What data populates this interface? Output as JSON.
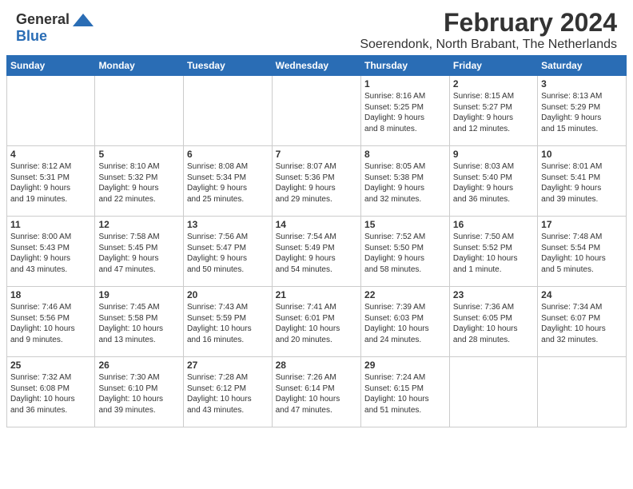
{
  "header": {
    "logo_general": "General",
    "logo_blue": "Blue",
    "title": "February 2024",
    "location": "Soerendonk, North Brabant, The Netherlands"
  },
  "days": [
    "Sunday",
    "Monday",
    "Tuesday",
    "Wednesday",
    "Thursday",
    "Friday",
    "Saturday"
  ],
  "weeks": [
    [
      {
        "day": "",
        "info": ""
      },
      {
        "day": "",
        "info": ""
      },
      {
        "day": "",
        "info": ""
      },
      {
        "day": "",
        "info": ""
      },
      {
        "day": "1",
        "info": "Sunrise: 8:16 AM\nSunset: 5:25 PM\nDaylight: 9 hours\nand 8 minutes."
      },
      {
        "day": "2",
        "info": "Sunrise: 8:15 AM\nSunset: 5:27 PM\nDaylight: 9 hours\nand 12 minutes."
      },
      {
        "day": "3",
        "info": "Sunrise: 8:13 AM\nSunset: 5:29 PM\nDaylight: 9 hours\nand 15 minutes."
      }
    ],
    [
      {
        "day": "4",
        "info": "Sunrise: 8:12 AM\nSunset: 5:31 PM\nDaylight: 9 hours\nand 19 minutes."
      },
      {
        "day": "5",
        "info": "Sunrise: 8:10 AM\nSunset: 5:32 PM\nDaylight: 9 hours\nand 22 minutes."
      },
      {
        "day": "6",
        "info": "Sunrise: 8:08 AM\nSunset: 5:34 PM\nDaylight: 9 hours\nand 25 minutes."
      },
      {
        "day": "7",
        "info": "Sunrise: 8:07 AM\nSunset: 5:36 PM\nDaylight: 9 hours\nand 29 minutes."
      },
      {
        "day": "8",
        "info": "Sunrise: 8:05 AM\nSunset: 5:38 PM\nDaylight: 9 hours\nand 32 minutes."
      },
      {
        "day": "9",
        "info": "Sunrise: 8:03 AM\nSunset: 5:40 PM\nDaylight: 9 hours\nand 36 minutes."
      },
      {
        "day": "10",
        "info": "Sunrise: 8:01 AM\nSunset: 5:41 PM\nDaylight: 9 hours\nand 39 minutes."
      }
    ],
    [
      {
        "day": "11",
        "info": "Sunrise: 8:00 AM\nSunset: 5:43 PM\nDaylight: 9 hours\nand 43 minutes."
      },
      {
        "day": "12",
        "info": "Sunrise: 7:58 AM\nSunset: 5:45 PM\nDaylight: 9 hours\nand 47 minutes."
      },
      {
        "day": "13",
        "info": "Sunrise: 7:56 AM\nSunset: 5:47 PM\nDaylight: 9 hours\nand 50 minutes."
      },
      {
        "day": "14",
        "info": "Sunrise: 7:54 AM\nSunset: 5:49 PM\nDaylight: 9 hours\nand 54 minutes."
      },
      {
        "day": "15",
        "info": "Sunrise: 7:52 AM\nSunset: 5:50 PM\nDaylight: 9 hours\nand 58 minutes."
      },
      {
        "day": "16",
        "info": "Sunrise: 7:50 AM\nSunset: 5:52 PM\nDaylight: 10 hours\nand 1 minute."
      },
      {
        "day": "17",
        "info": "Sunrise: 7:48 AM\nSunset: 5:54 PM\nDaylight: 10 hours\nand 5 minutes."
      }
    ],
    [
      {
        "day": "18",
        "info": "Sunrise: 7:46 AM\nSunset: 5:56 PM\nDaylight: 10 hours\nand 9 minutes."
      },
      {
        "day": "19",
        "info": "Sunrise: 7:45 AM\nSunset: 5:58 PM\nDaylight: 10 hours\nand 13 minutes."
      },
      {
        "day": "20",
        "info": "Sunrise: 7:43 AM\nSunset: 5:59 PM\nDaylight: 10 hours\nand 16 minutes."
      },
      {
        "day": "21",
        "info": "Sunrise: 7:41 AM\nSunset: 6:01 PM\nDaylight: 10 hours\nand 20 minutes."
      },
      {
        "day": "22",
        "info": "Sunrise: 7:39 AM\nSunset: 6:03 PM\nDaylight: 10 hours\nand 24 minutes."
      },
      {
        "day": "23",
        "info": "Sunrise: 7:36 AM\nSunset: 6:05 PM\nDaylight: 10 hours\nand 28 minutes."
      },
      {
        "day": "24",
        "info": "Sunrise: 7:34 AM\nSunset: 6:07 PM\nDaylight: 10 hours\nand 32 minutes."
      }
    ],
    [
      {
        "day": "25",
        "info": "Sunrise: 7:32 AM\nSunset: 6:08 PM\nDaylight: 10 hours\nand 36 minutes."
      },
      {
        "day": "26",
        "info": "Sunrise: 7:30 AM\nSunset: 6:10 PM\nDaylight: 10 hours\nand 39 minutes."
      },
      {
        "day": "27",
        "info": "Sunrise: 7:28 AM\nSunset: 6:12 PM\nDaylight: 10 hours\nand 43 minutes."
      },
      {
        "day": "28",
        "info": "Sunrise: 7:26 AM\nSunset: 6:14 PM\nDaylight: 10 hours\nand 47 minutes."
      },
      {
        "day": "29",
        "info": "Sunrise: 7:24 AM\nSunset: 6:15 PM\nDaylight: 10 hours\nand 51 minutes."
      },
      {
        "day": "",
        "info": ""
      },
      {
        "day": "",
        "info": ""
      }
    ]
  ]
}
